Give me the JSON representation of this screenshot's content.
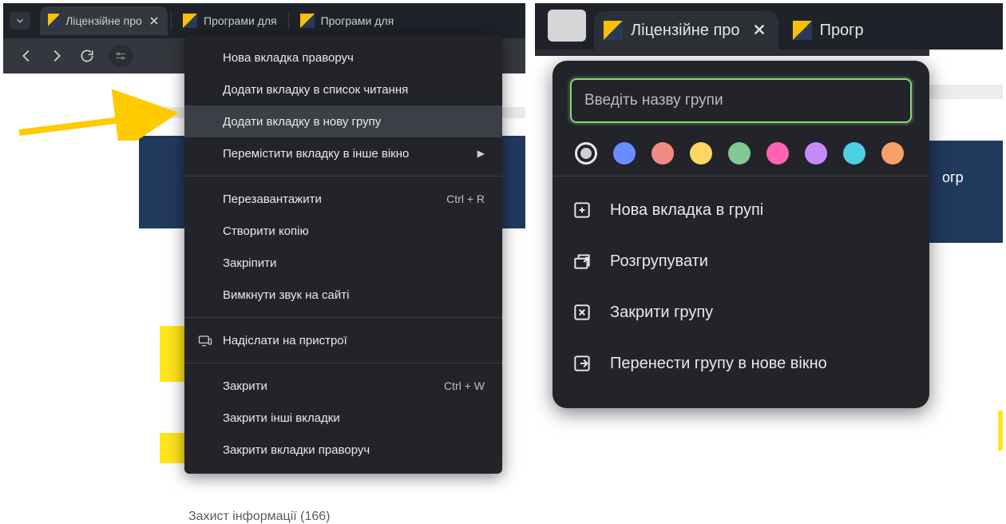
{
  "left": {
    "tabs": [
      {
        "label": "Ліцензійне про"
      },
      {
        "label": "Програми для"
      },
      {
        "label": "Програми для"
      }
    ],
    "context_menu": {
      "items": [
        {
          "label": "Нова вкладка праворуч"
        },
        {
          "label": "Додати вкладку в список читання"
        },
        {
          "label": "Додати вкладку в нову групу",
          "hovered": true
        },
        {
          "label": "Перемістити вкладку в інше вікно",
          "submenu": true
        }
      ],
      "items2": [
        {
          "label": "Перезавантажити",
          "shortcut": "Ctrl + R"
        },
        {
          "label": "Створити копію"
        },
        {
          "label": "Закріпити"
        },
        {
          "label": "Вимкнути звук на сайті"
        }
      ],
      "items3": [
        {
          "label": "Надіслати на пристрої",
          "icon": "devices"
        }
      ],
      "items4": [
        {
          "label": "Закрити",
          "shortcut": "Ctrl + W"
        },
        {
          "label": "Закрити інші вкладки"
        },
        {
          "label": "Закрити вкладки праворуч"
        }
      ]
    },
    "page_text_partial": "Захист інформації (166)"
  },
  "right": {
    "tabs": [
      {
        "label": "Ліцензійне про"
      },
      {
        "label": "Прогр"
      }
    ],
    "page_text_partial": "огр",
    "group_popup": {
      "input_placeholder": "Введіть назву групи",
      "colors": [
        "#cfcfcf",
        "#6a8cff",
        "#f28b82",
        "#fdd663",
        "#81c995",
        "#ff63b1",
        "#c58af9",
        "#4dd0e1",
        "#f5a16a"
      ],
      "selected_color_index": 0,
      "items": [
        {
          "icon": "new-tab-in-group",
          "label": "Нова вкладка в групі"
        },
        {
          "icon": "ungroup",
          "label": "Розгрупувати"
        },
        {
          "icon": "close-group",
          "label": "Закрити групу"
        },
        {
          "icon": "move-window",
          "label": "Перенести групу в нове вікно"
        }
      ]
    }
  }
}
